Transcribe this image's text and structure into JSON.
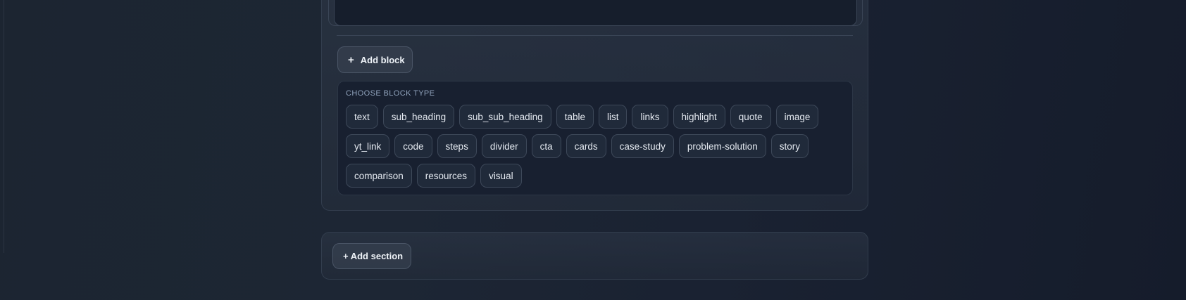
{
  "editor": {
    "add_block_label": "Add block",
    "chooser_title": "CHOOSE BLOCK TYPE",
    "block_types": [
      "text",
      "sub_heading",
      "sub_sub_heading",
      "table",
      "list",
      "links",
      "highlight",
      "quote",
      "image",
      "yt_link",
      "code",
      "steps",
      "divider",
      "cta",
      "cards",
      "case-study",
      "problem-solution",
      "story",
      "comparison",
      "resources",
      "visual"
    ],
    "add_section_label": "+ Add section"
  },
  "colors": {
    "background": "#1b2331",
    "panel_border": "#323d4d",
    "chip_background": "#202a3a",
    "label_accent": "#8fa2bb"
  }
}
